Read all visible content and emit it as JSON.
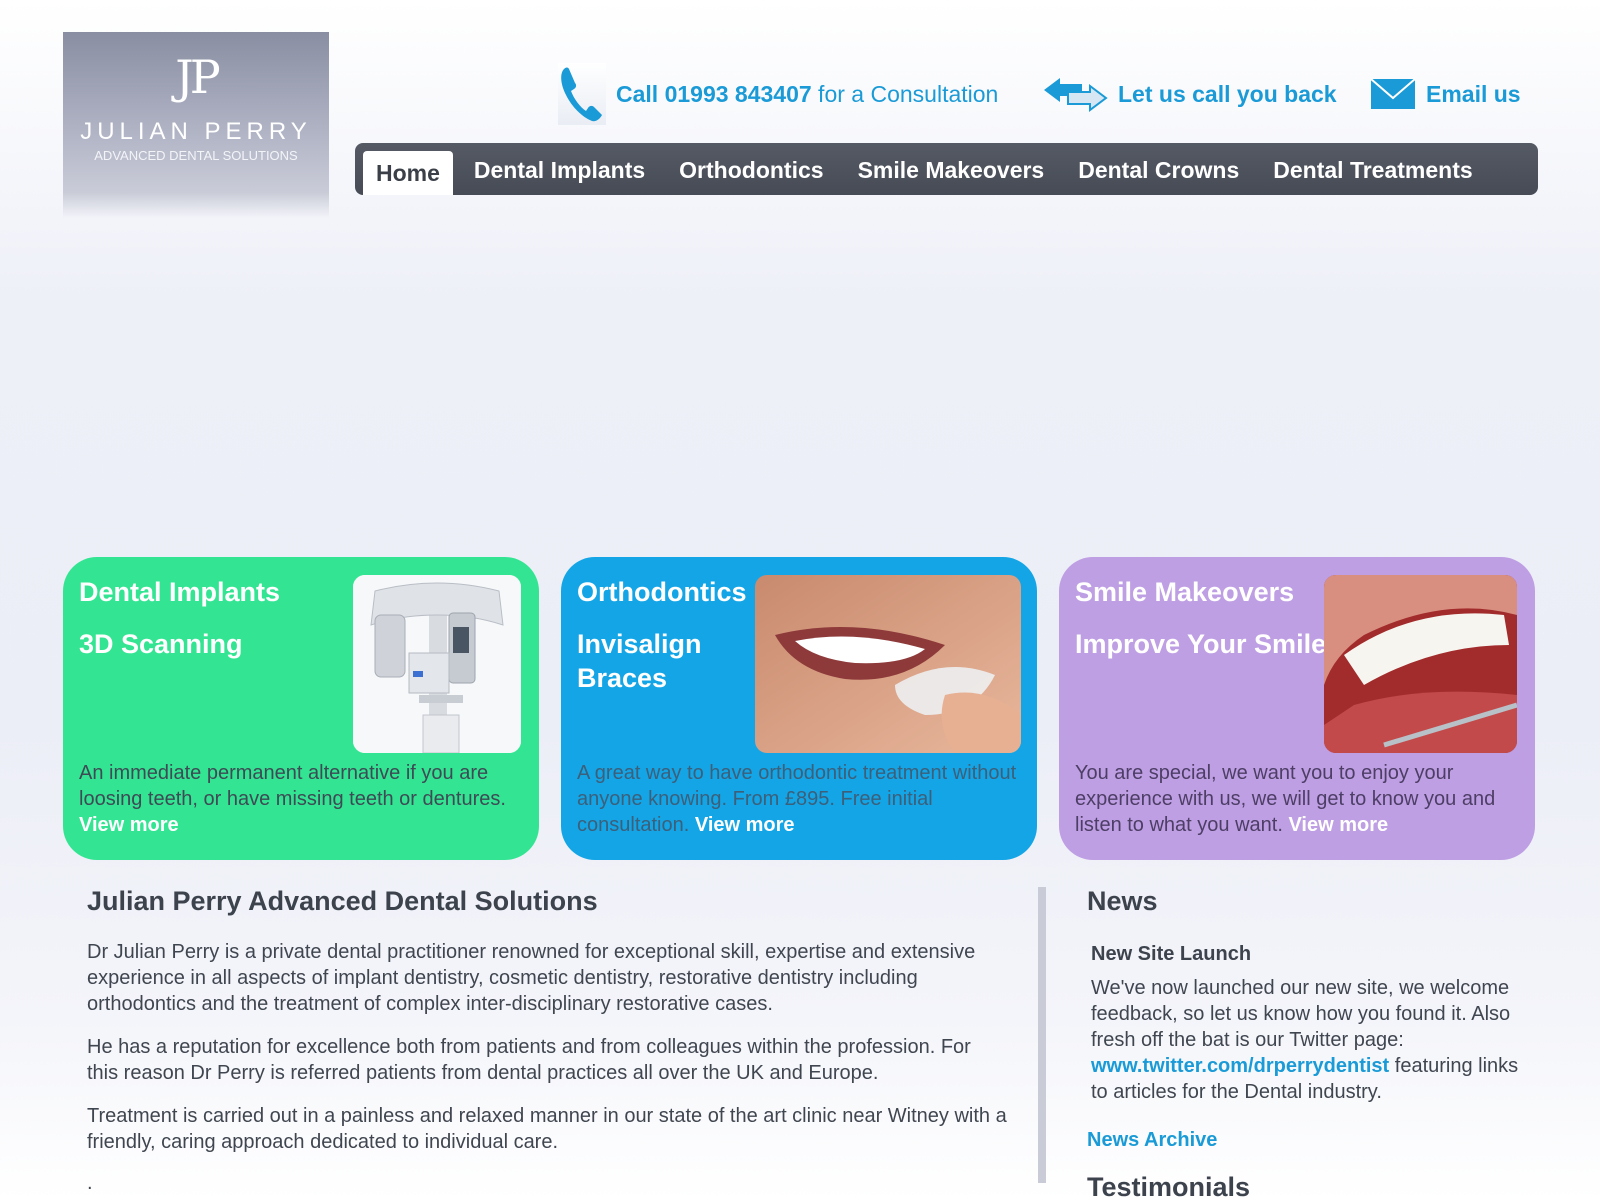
{
  "logo": {
    "monogram": "JP",
    "name": "JULIAN PERRY",
    "tagline": "ADVANCED DENTAL SOLUTIONS"
  },
  "contact": {
    "call_prefix": "Call 01993 843407",
    "call_suffix": " for a Consultation",
    "callback": "Let us call you back",
    "email": "Email us"
  },
  "nav": {
    "items": [
      {
        "label": "Home"
      },
      {
        "label": "Dental Implants"
      },
      {
        "label": "Orthodontics"
      },
      {
        "label": "Smile Makeovers"
      },
      {
        "label": "Dental Crowns"
      },
      {
        "label": "Dental Treatments"
      }
    ]
  },
  "cards": [
    {
      "title": "Dental Implants",
      "subtitle": "3D Scanning",
      "desc": "An immediate permanent alternative if you are loosing teeth, or have missing teeth or dentures.",
      "more": "View more"
    },
    {
      "title": "Orthodontics",
      "subtitle": "Invisalign Braces",
      "desc": "A great way to have orthodontic treatment without anyone knowing. From £895. Free initial consultation.",
      "more": "View more"
    },
    {
      "title": "Smile Makeovers",
      "subtitle": "Improve Your Smile",
      "desc": "You are special, we want you to enjoy your experience with us, we will get to know you and listen to what you want.",
      "more": "View more"
    }
  ],
  "main": {
    "title": "Julian Perry Advanced Dental Solutions",
    "paragraphs": [
      "Dr Julian Perry is a private dental practitioner renowned for exceptional skill, expertise and extensive experience in all aspects of implant dentistry, cosmetic dentistry, restorative dentistry including orthodontics and the treatment of complex inter-disciplinary restorative cases.",
      "He has a reputation for excellence both from patients and from colleagues within the profession. For this reason Dr Perry is referred patients from dental practices all over the UK and Europe.",
      "Treatment is carried out in a painless and relaxed manner in our state of the art clinic near Witney with a friendly, caring approach dedicated to individual care."
    ],
    "trailing": "."
  },
  "news": {
    "title": "News",
    "item_title": "New Site Launch",
    "item_body_1": "We've now launched our new site, we welcome feedback, so let us know how you found it. Also fresh off the bat is our Twitter page: ",
    "item_link": "www.twitter.com/drperrydentist",
    "item_body_2": " featuring links to articles for the Dental industry.",
    "archive": "News Archive",
    "testimonials": "Testimonials"
  },
  "colors": {
    "accent_blue": "#1a9ad6",
    "nav_bg": "#4b505a",
    "card_green": "#33e592",
    "card_blue": "#14a5e6",
    "card_purple": "#bf9fe3"
  }
}
